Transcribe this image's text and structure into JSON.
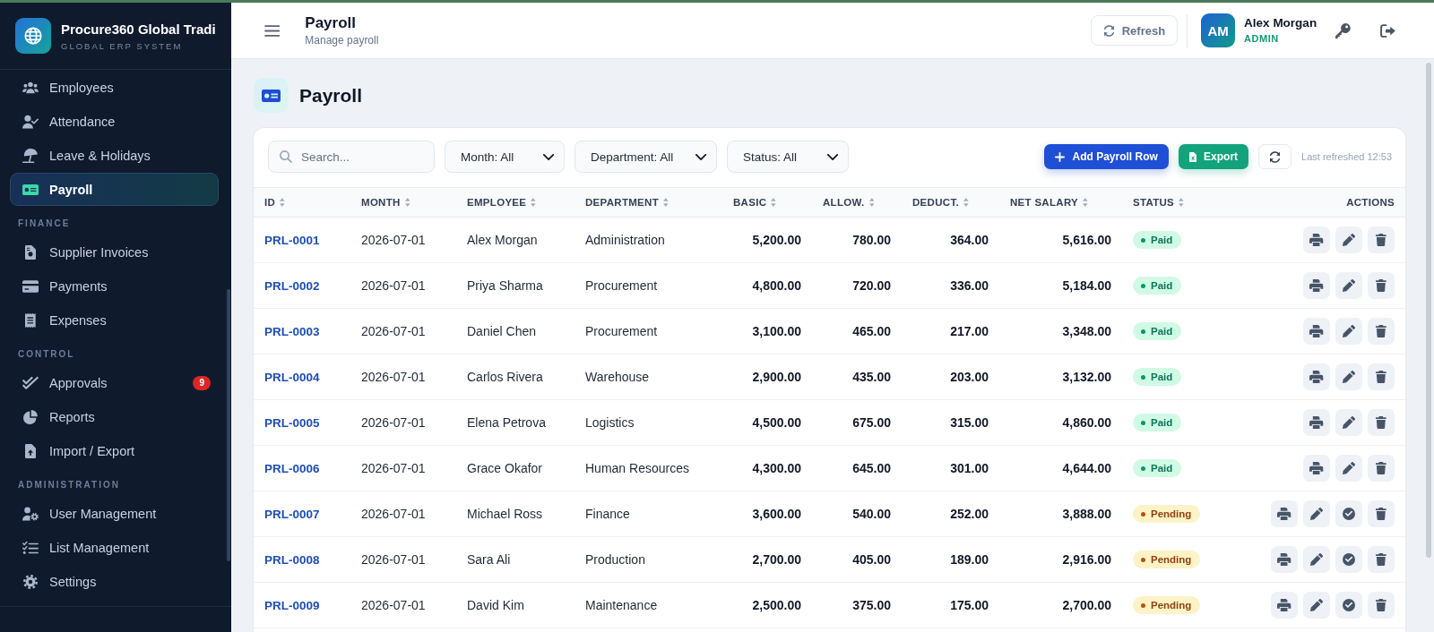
{
  "app": {
    "name": "Procure360 Global Tradi",
    "tagline": "GLOBAL ERP SYSTEM"
  },
  "sidebar": {
    "sections": [
      {
        "items": [
          {
            "label": "Employees",
            "selected": false
          },
          {
            "label": "Attendance",
            "selected": false
          },
          {
            "label": "Leave & Holidays",
            "selected": false
          },
          {
            "label": "Payroll",
            "selected": true
          }
        ]
      },
      {
        "heading": "FINANCE",
        "items": [
          {
            "label": "Supplier Invoices",
            "selected": false
          },
          {
            "label": "Payments",
            "selected": false
          },
          {
            "label": "Expenses",
            "selected": false
          }
        ]
      },
      {
        "heading": "CONTROL",
        "items": [
          {
            "label": "Approvals",
            "selected": false,
            "badge": "9"
          },
          {
            "label": "Reports",
            "selected": false
          },
          {
            "label": "Import / Export",
            "selected": false
          }
        ]
      },
      {
        "heading": "ADMINISTRATION",
        "items": [
          {
            "label": "User Management",
            "selected": false
          },
          {
            "label": "List Management",
            "selected": false
          },
          {
            "label": "Settings",
            "selected": false
          }
        ]
      }
    ]
  },
  "header": {
    "title": "Payroll",
    "subtitle": "Manage payroll",
    "refresh_button": "Refresh",
    "user": {
      "initials": "AM",
      "name": "Alex Morgan",
      "role": "ADMIN"
    }
  },
  "page": {
    "title": "Payroll"
  },
  "toolbar": {
    "search": {
      "placeholder": "Search..."
    },
    "filters": [
      "Month: All",
      "Department: All",
      "Status: All"
    ],
    "add_button": "Add Payroll Row",
    "export_button": "Export",
    "last_refreshed": "Last refreshed 12:53"
  },
  "table": {
    "columns": [
      {
        "label": "ID",
        "sortable": true,
        "kind": "link"
      },
      {
        "label": "MONTH",
        "sortable": true,
        "kind": "text"
      },
      {
        "label": "EMPLOYEE",
        "sortable": true,
        "kind": "text"
      },
      {
        "label": "DEPARTMENT",
        "sortable": true,
        "kind": "text"
      },
      {
        "label": "BASIC",
        "sortable": true,
        "kind": "amount"
      },
      {
        "label": "ALLOW.",
        "sortable": true,
        "kind": "amount"
      },
      {
        "label": "DEDUCT.",
        "sortable": true,
        "kind": "amount"
      },
      {
        "label": "NET SALARY",
        "sortable": true,
        "kind": "amount"
      },
      {
        "label": "STATUS",
        "sortable": true,
        "kind": "status"
      },
      {
        "label": "ACTIONS",
        "sortable": false,
        "kind": "actions"
      }
    ],
    "rows": [
      {
        "id": "PRL-0001",
        "month": "2026-07-01",
        "employee": "Alex Morgan",
        "department": "Administration",
        "basic": "5,200.00",
        "allowance": "780.00",
        "deduction": "364.00",
        "net_salary": "5,616.00",
        "status": {
          "label": "Paid",
          "kind": "paid"
        },
        "approvable": false
      },
      {
        "id": "PRL-0002",
        "month": "2026-07-01",
        "employee": "Priya Sharma",
        "department": "Procurement",
        "basic": "4,800.00",
        "allowance": "720.00",
        "deduction": "336.00",
        "net_salary": "5,184.00",
        "status": {
          "label": "Paid",
          "kind": "paid"
        },
        "approvable": false
      },
      {
        "id": "PRL-0003",
        "month": "2026-07-01",
        "employee": "Daniel Chen",
        "department": "Procurement",
        "basic": "3,100.00",
        "allowance": "465.00",
        "deduction": "217.00",
        "net_salary": "3,348.00",
        "status": {
          "label": "Paid",
          "kind": "paid"
        },
        "approvable": false
      },
      {
        "id": "PRL-0004",
        "month": "2026-07-01",
        "employee": "Carlos Rivera",
        "department": "Warehouse",
        "basic": "2,900.00",
        "allowance": "435.00",
        "deduction": "203.00",
        "net_salary": "3,132.00",
        "status": {
          "label": "Paid",
          "kind": "paid"
        },
        "approvable": false
      },
      {
        "id": "PRL-0005",
        "month": "2026-07-01",
        "employee": "Elena Petrova",
        "department": "Logistics",
        "basic": "4,500.00",
        "allowance": "675.00",
        "deduction": "315.00",
        "net_salary": "4,860.00",
        "status": {
          "label": "Paid",
          "kind": "paid"
        },
        "approvable": false
      },
      {
        "id": "PRL-0006",
        "month": "2026-07-01",
        "employee": "Grace Okafor",
        "department": "Human Resources",
        "basic": "4,300.00",
        "allowance": "645.00",
        "deduction": "301.00",
        "net_salary": "4,644.00",
        "status": {
          "label": "Paid",
          "kind": "paid"
        },
        "approvable": false
      },
      {
        "id": "PRL-0007",
        "month": "2026-07-01",
        "employee": "Michael Ross",
        "department": "Finance",
        "basic": "3,600.00",
        "allowance": "540.00",
        "deduction": "252.00",
        "net_salary": "3,888.00",
        "status": {
          "label": "Pending",
          "kind": "pending"
        },
        "approvable": true
      },
      {
        "id": "PRL-0008",
        "month": "2026-07-01",
        "employee": "Sara Ali",
        "department": "Production",
        "basic": "2,700.00",
        "allowance": "405.00",
        "deduction": "189.00",
        "net_salary": "2,916.00",
        "status": {
          "label": "Pending",
          "kind": "pending"
        },
        "approvable": true
      },
      {
        "id": "PRL-0009",
        "month": "2026-07-01",
        "employee": "David Kim",
        "department": "Maintenance",
        "basic": "2,500.00",
        "allowance": "375.00",
        "deduction": "175.00",
        "net_salary": "2,700.00",
        "status": {
          "label": "Pending",
          "kind": "pending"
        },
        "approvable": true
      }
    ]
  }
}
